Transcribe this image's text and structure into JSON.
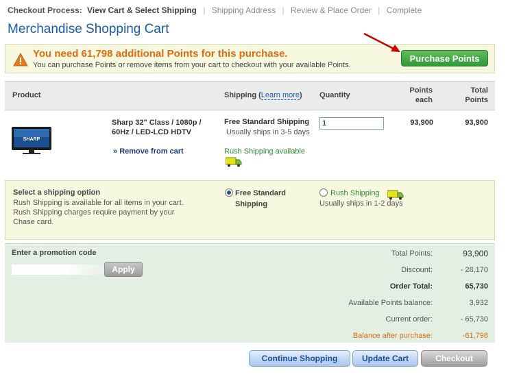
{
  "breadcrumb": {
    "lead": "Checkout Process:",
    "current": "View Cart & Select Shipping",
    "steps": [
      "Shipping Address",
      "Review & Place Order",
      "Complete"
    ]
  },
  "page_title": "Merchandise Shopping Cart",
  "alert": {
    "icon": "warning-icon",
    "title": "You need 61,798 additional Points for this purchase.",
    "subtitle": "You can purchase Points or remove items from your cart to checkout with your available Points.",
    "button": "Purchase Points"
  },
  "table_header": {
    "product": "Product",
    "shipping": "Shipping (",
    "learn_more": "Learn more",
    "shipping_close": ")",
    "quantity": "Quantity",
    "points_each_1": "Points",
    "points_each_2": "each",
    "total_points_1": "Total",
    "total_points_2": "Points"
  },
  "item": {
    "image": "tv-icon",
    "name": "Sharp 32\" Class / 1080p / 60Hz / LED-LCD HDTV",
    "remove_prefix": "»",
    "remove": "Remove from cart",
    "shipping_title": "Free Standard Shipping",
    "shipping_sub": "Usually ships in 3-5 days",
    "rush_available": "Rush Shipping available",
    "quantity": "1",
    "points_each": "93,900",
    "points_total": "93,900"
  },
  "shipping_option": {
    "title": "Select a shipping option",
    "text": "Rush Shipping is available for all items in your cart. Rush Shipping charges require payment by your Chase card.",
    "option1_label": "Free Standard Shipping",
    "option1_selected": true,
    "option2_label": "Rush Shipping",
    "option2_sub": "Usually ships in 1-2 days",
    "option2_selected": false
  },
  "summary": {
    "promo_label": "Enter a promotion code",
    "promo_value": "",
    "apply": "Apply",
    "rows": [
      {
        "label": "Total Points:",
        "value": "93,900"
      },
      {
        "label": "Discount:",
        "value": "- 28,170"
      },
      {
        "label": "Order Total:",
        "value": "65,730"
      },
      {
        "label": "Available Points balance:",
        "value": "3,932"
      },
      {
        "label": "Current order:",
        "value": "- 65,730"
      },
      {
        "label": "Balance after purchase:",
        "value": "-61,798"
      }
    ]
  },
  "buttons": {
    "continue": "Continue Shopping",
    "update": "Update Cart",
    "checkout": "Checkout"
  },
  "colors": {
    "title_blue": "#1a5aa6",
    "warning_orange": "#e06b10",
    "green_button": "#2e9a36",
    "panel_yellow": "#f7f8e0",
    "panel_green": "#e3efe3"
  }
}
